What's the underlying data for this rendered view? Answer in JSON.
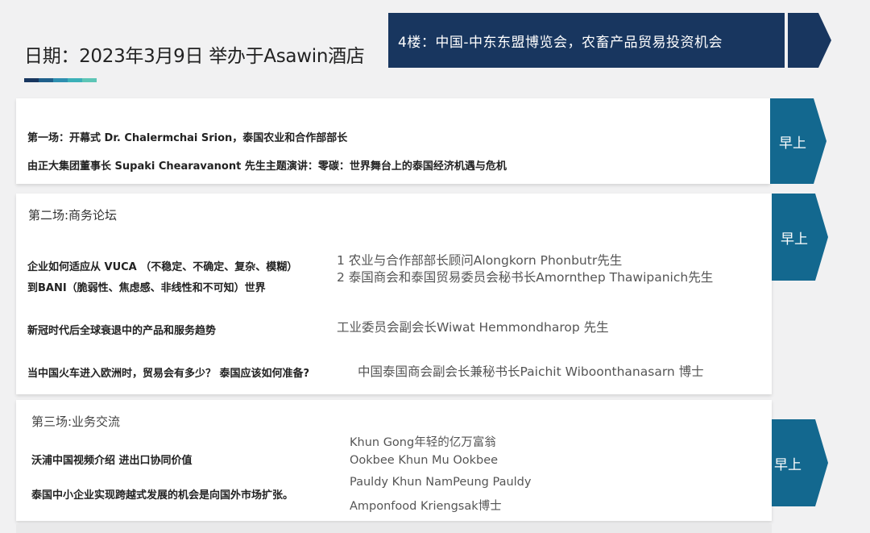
{
  "header": {
    "title": "日期：2023年3月9日 举办于Asawin酒店",
    "floor_banner": "4楼：中国-中东东盟博览会，农畜产品贸易投资机会"
  },
  "session1": {
    "time_tag": "早上",
    "line1": "第一场：开幕式 Dr. Chalermchai Srion，泰国农业和合作部部长",
    "line2": "由正大集团董事长 Supaki Chearavanont 先生主题演讲：零碳：世界舞台上的泰国经济机遇与危机"
  },
  "session2": {
    "time_tag": "早上",
    "title": "第二场:商务论坛",
    "topics": [
      {
        "text_lines": [
          "企业如何适应从 VUCA （不稳定、不确定、复杂、模糊）",
          "到BANI（脆弱性、焦虑感、非线性和不可知）世界"
        ],
        "speaker_lines": [
          "1 农业与合作部部长顾问Alongkorn Phonbutr先生",
          "2 泰国商会和泰国贸易委员会秘书长Amornthep Thawipanich先生"
        ]
      },
      {
        "text_lines": [
          "新冠时代后全球衰退中的产品和服务趋势"
        ],
        "speaker_lines": [
          "工业委员会副会长Wiwat Hemmondharop 先生"
        ]
      },
      {
        "text_lines": [
          "当中国火车进入欧洲时，贸易会有多少？ 泰国应该如何准备?"
        ],
        "speaker_lines": [
          "中国泰国商会副会长兼秘书长Paichit Wiboonthanasarn 博士"
        ]
      }
    ]
  },
  "session3": {
    "time_tag": "早上",
    "title": "第三场:业务交流",
    "topics": [
      "沃浦中国视频介绍 进出口协同价值",
      "泰国中小企业实现跨越式发展的机会是向国外市场扩张。"
    ],
    "speakers": [
      "Khun Gong年轻的亿万富翁",
      "Ookbee Khun Mu Ookbee",
      "Pauldy Khun NamPeung Pauldy",
      "Amponfood Kriengsak博士"
    ]
  },
  "colors": {
    "navy": "#18365f",
    "teal": "#13688f",
    "accent_segments": [
      "#18365f",
      "#1f5f8b",
      "#2e8fb0",
      "#3bb0b8",
      "#5dc5b6"
    ]
  }
}
